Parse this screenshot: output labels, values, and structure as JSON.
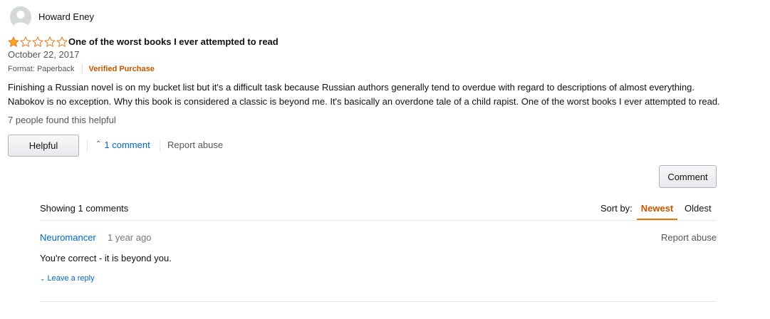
{
  "review": {
    "reviewer_name": "Howard Eney",
    "rating": 1,
    "rating_max": 5,
    "title": "One of the worst books I ever attempted to read",
    "date": "October 22, 2017",
    "format": "Format: Paperback",
    "verified_label": "Verified Purchase",
    "body_lines": [
      "Finishing a Russian novel is on my bucket list but it's a difficult task because Russian authors generally tend to overdue with regard to descriptions of almost everything.",
      "Nabokov is no exception. Why this book is considered a classic is beyond me. It's basically an overdone tale of a child rapist. One of the worst books I ever attempted to read."
    ],
    "helpful_count_text": "7 people found this helpful",
    "helpful_button_label": "Helpful",
    "comments_toggle_label": "1 comment",
    "report_abuse_label": "Report abuse"
  },
  "comments": {
    "comment_button_label": "Comment",
    "showing_text": "Showing 1 comments",
    "sort_label": "Sort by:",
    "sort_options": [
      "Newest",
      "Oldest"
    ],
    "sort_selected": "Newest",
    "items": [
      {
        "author": "Neuromancer",
        "time": "1 year ago",
        "report_label": "Report abuse",
        "text": "You're correct - it is beyond you.",
        "reply_label": "Leave a reply"
      }
    ]
  },
  "colors": {
    "link": "#0066c0",
    "verified": "#c45500",
    "star_fill": "#ffa41c",
    "star_outline": "#de7921",
    "sort_underline": "#e77600"
  }
}
